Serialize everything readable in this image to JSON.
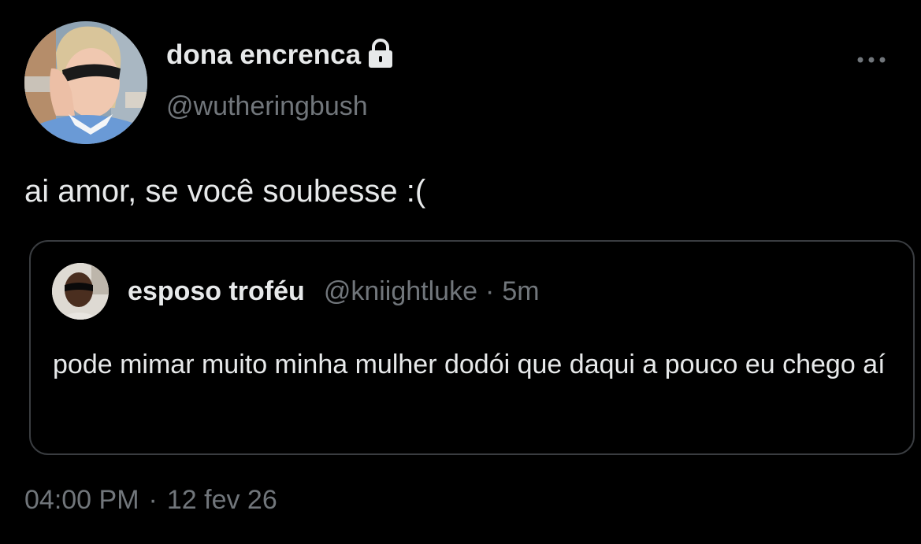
{
  "author": {
    "display_name": "dona encrenca",
    "handle": "@wutheringbush",
    "protected_icon": "lock-icon"
  },
  "tweet": {
    "text": "ai amor, se você soubesse :("
  },
  "quoted_tweet": {
    "display_name": "esposo troféu",
    "handle": "@kniightluke",
    "separator": "·",
    "time": "5m",
    "text": "pode mimar muito minha mulher dodói que daqui a pouco eu chego aí"
  },
  "timestamp": {
    "time": "04:00 PM",
    "separator": "·",
    "date": "12 fev 26"
  },
  "icons": {
    "more": "more-options-icon"
  },
  "colors": {
    "background": "#000000",
    "primary_text": "#e7e9ea",
    "secondary_text": "#71767b",
    "card_border": "#3a3d41"
  }
}
